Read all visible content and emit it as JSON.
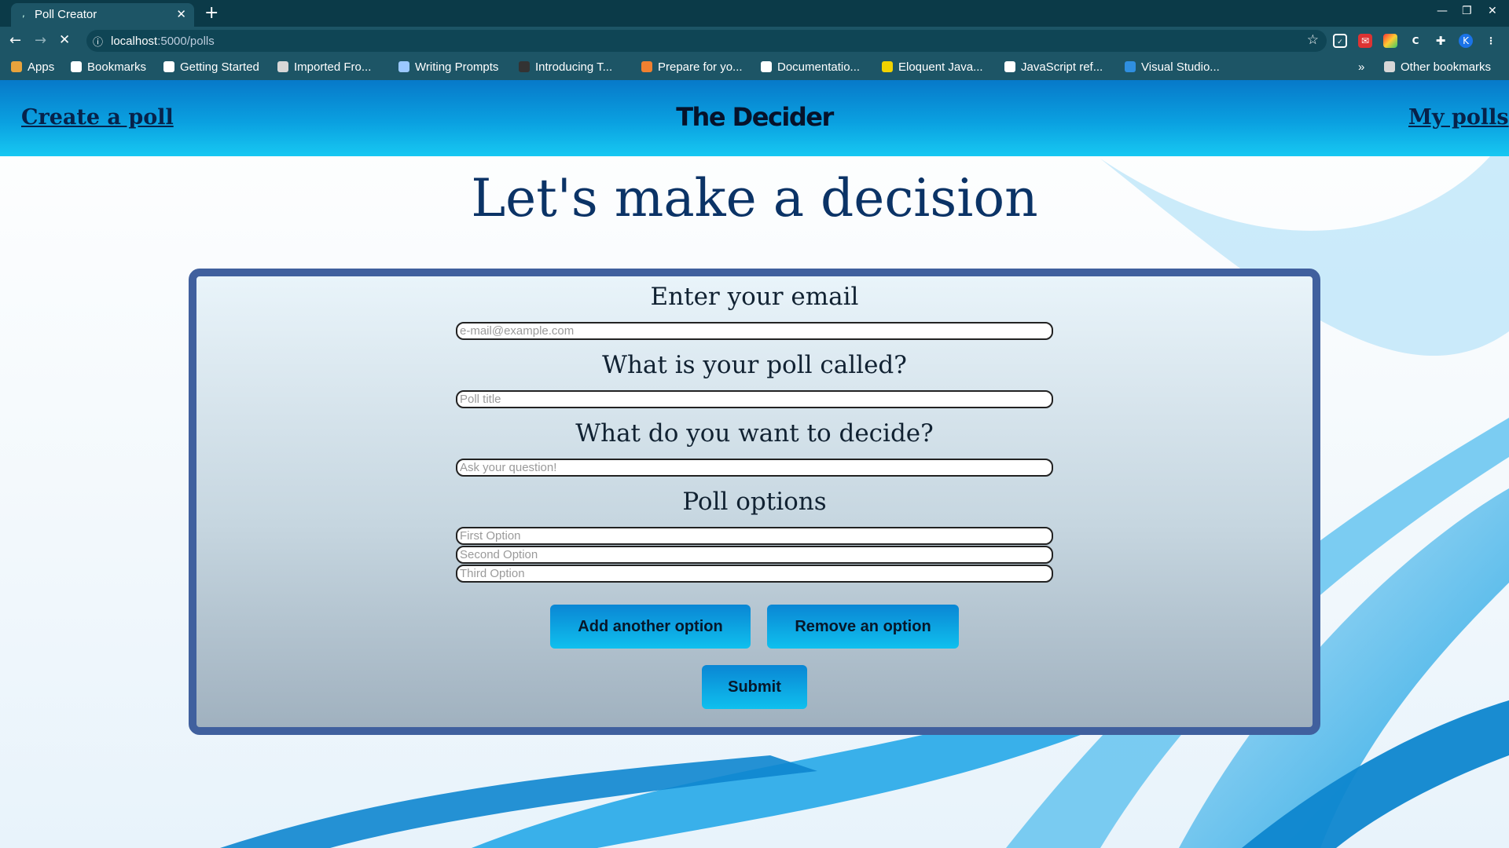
{
  "browser": {
    "tab": {
      "title": "Poll Creator"
    },
    "url": {
      "host": "localhost",
      "path": ":5000/polls"
    },
    "profile_initial": "K",
    "bookmarks": [
      {
        "label": "Apps",
        "color": "#e8a33c"
      },
      {
        "label": "Bookmarks",
        "color": "#ffffff"
      },
      {
        "label": "Getting Started",
        "color": "#ffffff"
      },
      {
        "label": "Imported Fro...",
        "color": "#d7d7d7"
      },
      {
        "label": "Writing Prompts",
        "color": "#9ac8ff"
      },
      {
        "label": "Introducing T...",
        "color": "#333333"
      },
      {
        "label": "Prepare for yo...",
        "color": "#f08030"
      },
      {
        "label": "Documentatio...",
        "color": "#ffffff"
      },
      {
        "label": "Eloquent Java...",
        "color": "#f2d300"
      },
      {
        "label": "JavaScript ref...",
        "color": "#ffffff"
      },
      {
        "label": "Visual Studio...",
        "color": "#2f8fe0"
      }
    ],
    "more_bookmarks": "»",
    "other_bookmarks": "Other bookmarks"
  },
  "header": {
    "left_link": "Create a poll",
    "brand": "The Decider",
    "right_link": "My polls"
  },
  "main": {
    "heading": "Let's make a decision",
    "form": {
      "email_label": "Enter your email",
      "email_placeholder": "e-mail@example.com",
      "title_label": "What is your poll called?",
      "title_placeholder": "Poll title",
      "question_label": "What do you want to decide?",
      "question_placeholder": "Ask your question!",
      "options_label": "Poll options",
      "options": [
        {
          "placeholder": "First Option"
        },
        {
          "placeholder": "Second Option"
        },
        {
          "placeholder": "Third Option"
        }
      ],
      "add_option_label": "Add another option",
      "remove_option_label": "Remove an option",
      "submit_label": "Submit"
    }
  },
  "colors": {
    "header_gradient_top": "#0779c9",
    "header_gradient_bottom": "#17c8f2",
    "heading": "#0b3366",
    "card_border": "#40609e",
    "button": "#0fa6e6"
  }
}
